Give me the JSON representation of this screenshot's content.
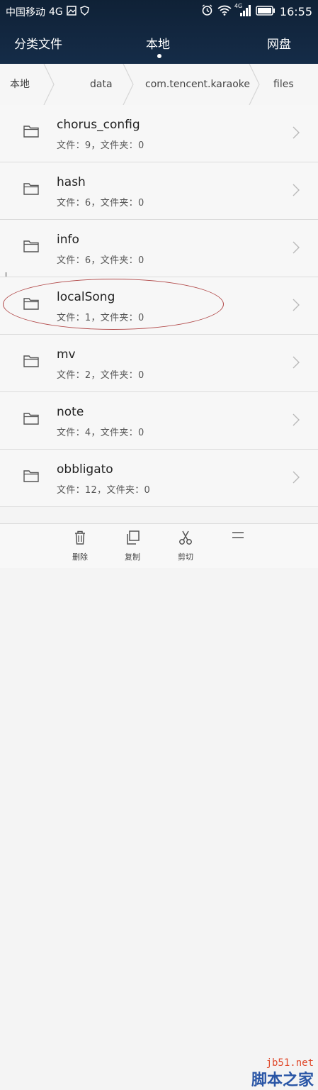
{
  "status_bar": {
    "carrier": "中国移动",
    "network": "4G",
    "signal_badge": "4G",
    "time": "16:55",
    "icons": [
      "gallery-icon",
      "shield-icon",
      "alarm-icon",
      "wifi-icon",
      "signal-icon",
      "battery-icon"
    ]
  },
  "tabs": [
    {
      "label": "分类文件",
      "active": false
    },
    {
      "label": "本地",
      "active": true
    },
    {
      "label": "网盘",
      "active": false
    }
  ],
  "breadcrumb": [
    "本地",
    "data",
    "com.tencent.karaoke",
    "files"
  ],
  "files": [
    {
      "name": "chorus_config",
      "meta": "文件：9，文件夹：0"
    },
    {
      "name": "hash",
      "meta": "文件：6，文件夹：0"
    },
    {
      "name": "info",
      "meta": "文件：6，文件夹：0"
    },
    {
      "name": "localSong",
      "meta": "文件：1，文件夹：0",
      "highlighted": true
    },
    {
      "name": "mv",
      "meta": "文件：2，文件夹：0"
    },
    {
      "name": "note",
      "meta": "文件：4，文件夹：0"
    },
    {
      "name": "obbligato",
      "meta": "文件：12，文件夹：0"
    }
  ],
  "actions": [
    {
      "label": "删除",
      "icon": "trash-icon"
    },
    {
      "label": "复制",
      "icon": "copy-icon"
    },
    {
      "label": "剪切",
      "icon": "scissors-icon"
    },
    {
      "label": "",
      "icon": "more-icon"
    }
  ],
  "watermark": {
    "url": "jb51.net",
    "text": "脚本之家"
  },
  "colors": {
    "header": "#13263f",
    "highlight_ellipse": "#b14848"
  }
}
